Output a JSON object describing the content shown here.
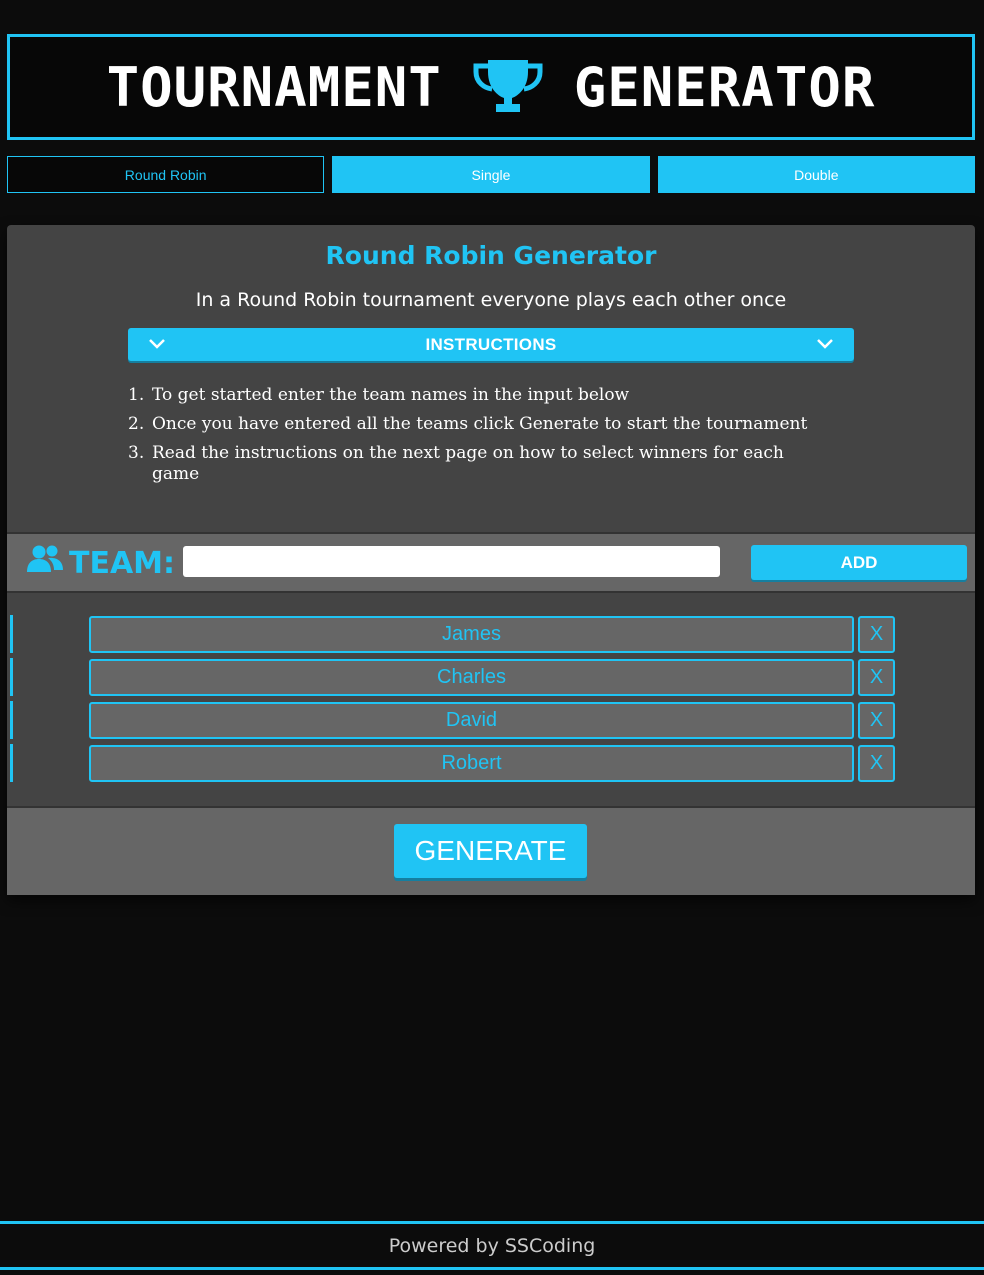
{
  "header": {
    "title_left": "TOURNAMENT",
    "title_right": "GENERATOR",
    "icon": "trophy-icon",
    "accent_color": "#20c4f4"
  },
  "tabs": [
    {
      "label": "Round Robin",
      "active": true
    },
    {
      "label": "Single",
      "active": false
    },
    {
      "label": "Double",
      "active": false
    }
  ],
  "panel": {
    "title": "Round Robin Generator",
    "subtitle": "In a Round Robin tournament everyone plays each other once",
    "instructions_label": "INSTRUCTIONS",
    "instructions": [
      {
        "num": "1.",
        "text": "To get started enter the team names in the input below"
      },
      {
        "num": "2.",
        "text": "Once you have entered all the teams click Generate to start the tournament"
      },
      {
        "num": "3.",
        "text": "Read the instructions on the next page on how to select winners for each game"
      }
    ]
  },
  "team_entry": {
    "label": "TEAM:",
    "icon": "users-icon",
    "input_value": "",
    "add_label": "ADD"
  },
  "teams": [
    {
      "name": "James",
      "delete_label": "X"
    },
    {
      "name": "Charles",
      "delete_label": "X"
    },
    {
      "name": "David",
      "delete_label": "X"
    },
    {
      "name": "Robert",
      "delete_label": "X"
    }
  ],
  "generate_label": "GENERATE",
  "footer": {
    "text": "Powered by SSCoding"
  }
}
